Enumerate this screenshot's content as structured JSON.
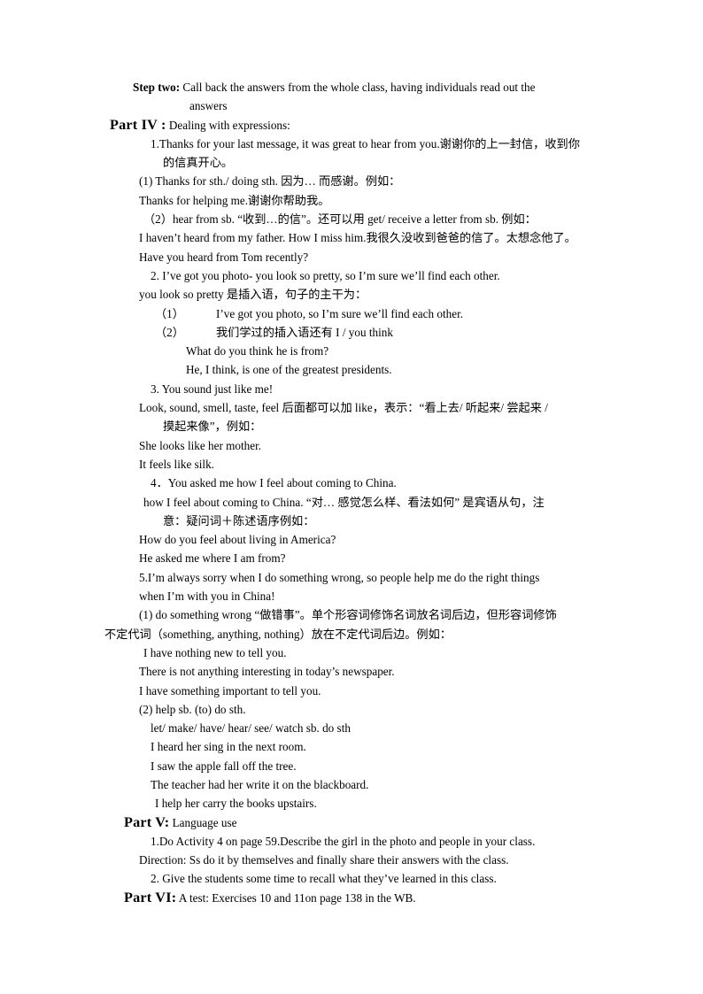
{
  "document": {
    "step_two": {
      "label": "Step two:",
      "text": "Call back the answers from the whole class, having individuals read out the",
      "continuation": "answers"
    },
    "part_iv": {
      "label": "Part IV :",
      "title": "Dealing with expressions:",
      "items": [
        {
          "id": "iv-1-a",
          "indent": "i2",
          "text": "1.Thanks for your last message, it was great to hear from you.谢谢你的上一封信，收到你"
        },
        {
          "id": "iv-1-b",
          "indent": "i3",
          "text": "的信真开心。"
        },
        {
          "id": "iv-1-c",
          "indent": "i1",
          "text": "(1) Thanks for sth./ doing sth. 因为… 而感谢。例如："
        },
        {
          "id": "iv-1-d",
          "indent": "i1",
          "text": "Thanks for helping me.谢谢你帮助我。"
        },
        {
          "id": "iv-1-e",
          "indent": "i1s",
          "text": "（2）hear from sb. “收到…的信”。还可以用 get/ receive a letter from sb. 例如："
        },
        {
          "id": "iv-1-f",
          "indent": "i1",
          "text": "I haven’t heard from my father. How I miss him.我很久没收到爸爸的信了。太想念他了。"
        },
        {
          "id": "iv-1-g",
          "indent": "i1",
          "text": "Have you heard from Tom recently?"
        },
        {
          "id": "iv-2-a",
          "indent": "i2",
          "text": "2. I’ve got you photo- you look so pretty, so I’m sure we’ll find each other."
        },
        {
          "id": "iv-2-b",
          "indent": "i1",
          "text": "you look so pretty 是插入语，句子的主干为："
        },
        {
          "id": "iv-2-c",
          "indent": "i2s",
          "marker": "（1）",
          "text": "I’ve got you photo, so I’m sure we’ll find each other."
        },
        {
          "id": "iv-2-d",
          "indent": "i2s",
          "marker": "（2）",
          "text": "我们学过的插入语还有 I / you think"
        },
        {
          "id": "iv-2-e",
          "indent": "i4",
          "text": "What do you think he is from?"
        },
        {
          "id": "iv-2-f",
          "indent": "i4",
          "text": "He, I think, is one of the greatest presidents."
        },
        {
          "id": "iv-3-a",
          "indent": "i2",
          "text": "3. You sound just like me!"
        },
        {
          "id": "iv-3-b",
          "indent": "i1",
          "text": "Look, sound, smell, taste, feel 后面都可以加 like，表示：“看上去/ 听起来/ 尝起来 /"
        },
        {
          "id": "iv-3-c",
          "indent": "i3",
          "text": "摸起来像”，例如："
        },
        {
          "id": "iv-3-d",
          "indent": "i1",
          "text": "She looks like her mother."
        },
        {
          "id": "iv-3-e",
          "indent": "i1",
          "text": "It feels like silk."
        },
        {
          "id": "iv-4-a",
          "indent": "i2",
          "text": "4．You asked me how I feel about coming to China."
        },
        {
          "id": "iv-4-b",
          "indent": "i1s",
          "text": "how I feel about coming to China. “对… 感觉怎么样、看法如何” 是宾语从句，注"
        },
        {
          "id": "iv-4-c",
          "indent": "i3",
          "text": "意：疑问词＋陈述语序例如："
        },
        {
          "id": "iv-4-d",
          "indent": "i1",
          "text": "How do you feel about living in America?"
        },
        {
          "id": "iv-4-e",
          "indent": "i1",
          "text": "He asked me where I am from?"
        }
      ],
      "item5": {
        "line1": "5.I’m always sorry when I do something wrong, so people help me do the right things",
        "line2": "when I’m with you in China!"
      },
      "items_after5": [
        {
          "id": "iv-5-a",
          "indent": "i1",
          "text": "(1) do something wrong  “做错事”。单个形容词修饰名词放名词后边，但形容词修饰"
        },
        {
          "id": "iv-5-b",
          "indent": "i0",
          "text": "不定代词（something, anything, nothing）放在不定代词后边。例如："
        },
        {
          "id": "iv-5-c",
          "indent": "i1s",
          "text": "I have nothing new to tell you."
        },
        {
          "id": "iv-5-d",
          "indent": "i1",
          "text": "There is not anything interesting in today’s newspaper."
        },
        {
          "id": "iv-5-e",
          "indent": "i1",
          "text": "I have something important to tell you."
        },
        {
          "id": "iv-5-f",
          "indent": "i1",
          "text": "(2) help sb. (to) do sth."
        },
        {
          "id": "iv-5-g",
          "indent": "i2",
          "text": "let/ make/ have/ hear/ see/ watch sb. do sth"
        },
        {
          "id": "iv-5-h",
          "indent": "i2",
          "text": "I heard her sing in the next room."
        },
        {
          "id": "iv-5-i",
          "indent": "i2",
          "text": "I saw the apple fall off the tree."
        },
        {
          "id": "iv-5-j",
          "indent": "i2",
          "text": "The teacher had her write it on the blackboard."
        },
        {
          "id": "iv-5-k",
          "indent": "i2s",
          "text": "I help her carry the books upstairs."
        }
      ]
    },
    "part_v": {
      "label": "Part V:",
      "title": "Language use",
      "items": [
        {
          "id": "v-1",
          "indent": "i2",
          "text": "1.Do Activity 4 on page 59.Describe the girl in the photo and people in your class."
        },
        {
          "id": "v-2",
          "indent": "i1",
          "text": "Direction: Ss do it by themselves and finally share their answers with the class."
        },
        {
          "id": "v-3",
          "indent": "i2",
          "text": "2. Give the students some time to recall what they’ve learned in this class."
        }
      ]
    },
    "part_vi": {
      "label": "Part VI:",
      "title": "A test: Exercises 10 and 11on page 138 in the WB."
    }
  }
}
